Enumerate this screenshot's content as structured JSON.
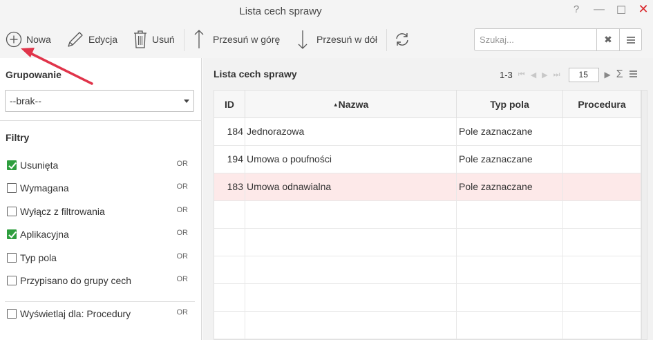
{
  "window": {
    "title": "Lista cech sprawy",
    "help_glyph": "?",
    "minimize_glyph": "—",
    "maximize_glyph": "☐",
    "close_glyph": "✕"
  },
  "toolbar": {
    "new_label": "Nowa",
    "edit_label": "Edycja",
    "delete_label": "Usuń",
    "move_up_label": "Przesuń w górę",
    "move_down_label": "Przesuń w dół",
    "search_placeholder": "Szukaj..."
  },
  "left_panel": {
    "grouping_title": "Grupowanie",
    "grouping_value": "--brak--",
    "filters_title": "Filtry",
    "filters": [
      {
        "label": "Usunięta",
        "checked": true,
        "or": "OR"
      },
      {
        "label": "Wymagana",
        "checked": false,
        "or": "OR"
      },
      {
        "label": "Wyłącz z filtrowania",
        "checked": false,
        "or": "OR"
      },
      {
        "label": "Aplikacyjna",
        "checked": true,
        "or": "OR"
      },
      {
        "label": "Typ pola",
        "checked": false,
        "or": "OR"
      },
      {
        "label": "Przypisano do grupy cech",
        "checked": false,
        "or": "OR"
      }
    ],
    "display_filter": {
      "label": "Wyświetlaj dla: Procedury",
      "checked": false,
      "or": "OR"
    }
  },
  "grid": {
    "title": "Lista cech sprawy",
    "pager": {
      "range": "1-3",
      "page_size": "15"
    },
    "columns": {
      "id": "ID",
      "name": "Nazwa",
      "type": "Typ pola",
      "procedure": "Procedura"
    },
    "rows": [
      {
        "id": "184",
        "name": "Jednorazowa",
        "type": "Pole zaznaczane",
        "procedure": ""
      },
      {
        "id": "194",
        "name": "Umowa o poufności",
        "type": "Pole zaznaczane",
        "procedure": ""
      },
      {
        "id": "183",
        "name": "Umowa odnawialna",
        "type": "Pole zaznaczane",
        "procedure": ""
      }
    ],
    "selected_row": 2,
    "empty_rows": 5
  },
  "colors": {
    "accent_green": "#2e9e3e",
    "selected_row": "#fde9e9",
    "close_red": "#d9262b",
    "annotation_arrow": "#e0344a"
  },
  "icons": [
    "plus-circle-icon",
    "pencil-icon",
    "trash-icon",
    "arrow-up-icon",
    "arrow-down-icon",
    "refresh-icon",
    "clear-icon",
    "menu-icon",
    "sigma-icon"
  ]
}
